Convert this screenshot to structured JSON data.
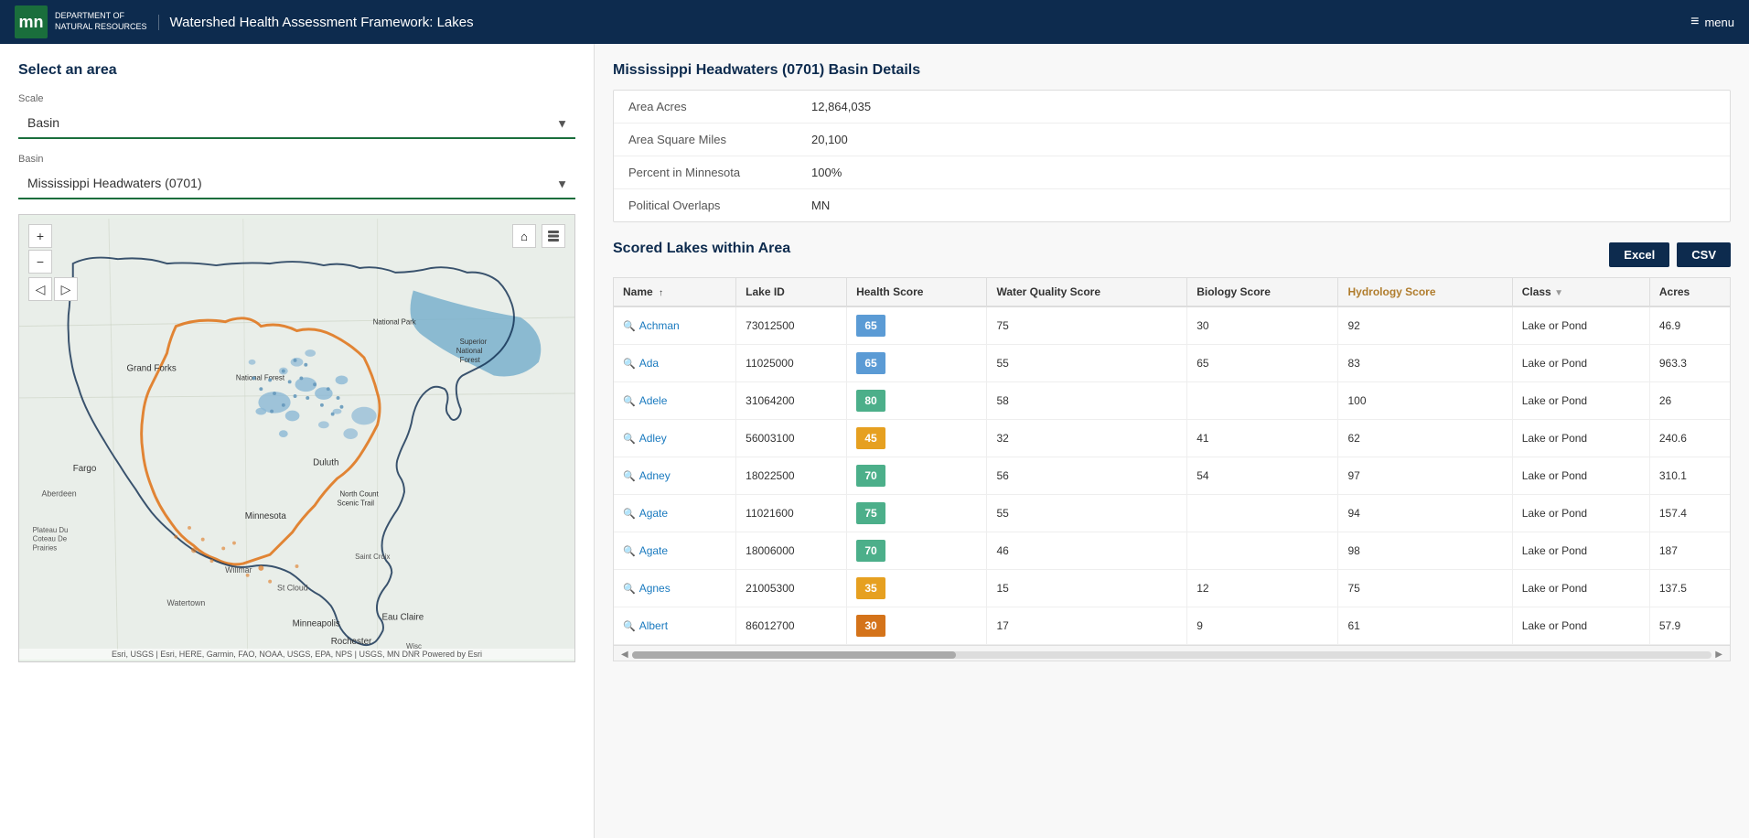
{
  "header": {
    "logo_letters": "mn",
    "logo_dept_line1": "Department of",
    "logo_dept_line2": "Natural Resources",
    "title": "Watershed Health Assessment Framework: Lakes",
    "menu_label": "menu"
  },
  "left_panel": {
    "section_title": "Select an area",
    "scale_label": "Scale",
    "scale_value": "Basin",
    "basin_label": "Basin",
    "basin_value": "Mississippi Headwaters (0701)",
    "map_attribution": "Esri, USGS | Esri, HERE, Garmin, FAO, NOAA, USGS, EPA, NPS | USGS, MN DNR     Powered by Esri"
  },
  "right_panel": {
    "basin_details_title": "Mississippi Headwaters (0701) Basin Details",
    "details": [
      {
        "label": "Area Acres",
        "value": "12,864,035"
      },
      {
        "label": "Area Square Miles",
        "value": "20,100"
      },
      {
        "label": "Percent in Minnesota",
        "value": "100%"
      },
      {
        "label": "Political Overlaps",
        "value": "MN"
      }
    ],
    "scored_lakes_title": "Scored Lakes within Area",
    "export_excel": "Excel",
    "export_csv": "CSV",
    "table": {
      "columns": [
        {
          "key": "name",
          "label": "Name",
          "sort": "asc"
        },
        {
          "key": "lake_id",
          "label": "Lake ID"
        },
        {
          "key": "health_score",
          "label": "Health Score"
        },
        {
          "key": "water_quality_score",
          "label": "Water Quality Score"
        },
        {
          "key": "biology_score",
          "label": "Biology Score"
        },
        {
          "key": "hydrology_score",
          "label": "Hydrology Score",
          "special": "hydrology"
        },
        {
          "key": "class",
          "label": "Class"
        },
        {
          "key": "acres",
          "label": "Acres"
        }
      ],
      "rows": [
        {
          "name": "Achman",
          "lake_id": "73012500",
          "health_score": 65,
          "health_color": "blue",
          "water_quality": 75,
          "biology": 30,
          "hydrology": 92,
          "class": "Lake or Pond",
          "acres": "46.9"
        },
        {
          "name": "Ada",
          "lake_id": "11025000",
          "health_score": 65,
          "health_color": "blue",
          "water_quality": 55,
          "biology": 65,
          "hydrology": 83,
          "class": "Lake or Pond",
          "acres": "963.3"
        },
        {
          "name": "Adele",
          "lake_id": "31064200",
          "health_score": 80,
          "health_color": "teal",
          "water_quality": 58,
          "biology": "",
          "hydrology": 100,
          "class": "Lake or Pond",
          "acres": "26"
        },
        {
          "name": "Adley",
          "lake_id": "56003100",
          "health_score": 45,
          "health_color": "orange",
          "water_quality": 32,
          "biology": 41,
          "hydrology": 62,
          "class": "Lake or Pond",
          "acres": "240.6"
        },
        {
          "name": "Adney",
          "lake_id": "18022500",
          "health_score": 70,
          "health_color": "teal",
          "water_quality": 56,
          "biology": 54,
          "hydrology": 97,
          "class": "Lake or Pond",
          "acres": "310.1"
        },
        {
          "name": "Agate",
          "lake_id": "11021600",
          "health_score": 75,
          "health_color": "teal",
          "water_quality": 55,
          "biology": "",
          "hydrology": 94,
          "class": "Lake or Pond",
          "acres": "157.4"
        },
        {
          "name": "Agate",
          "lake_id": "18006000",
          "health_score": 70,
          "health_color": "teal",
          "water_quality": 46,
          "biology": "",
          "hydrology": 98,
          "class": "Lake or Pond",
          "acres": "187"
        },
        {
          "name": "Agnes",
          "lake_id": "21005300",
          "health_score": 35,
          "health_color": "orange",
          "water_quality": 15,
          "biology": 12,
          "hydrology": 75,
          "class": "Lake or Pond",
          "acres": "137.5"
        },
        {
          "name": "Albert",
          "lake_id": "86012700",
          "health_score": 30,
          "health_color": "amber",
          "water_quality": 17,
          "biology": 9,
          "hydrology": 61,
          "class": "Lake or Pond",
          "acres": "57.9"
        }
      ]
    }
  },
  "colors": {
    "header_bg": "#0d2b4e",
    "logo_green": "#1a6e3c",
    "link_blue": "#1a7abf",
    "score_blue": "#5b9bd5",
    "score_teal": "#4caf8a",
    "score_orange": "#e6a020",
    "score_amber": "#d4731a",
    "hydrology_color": "#b07d2e"
  }
}
